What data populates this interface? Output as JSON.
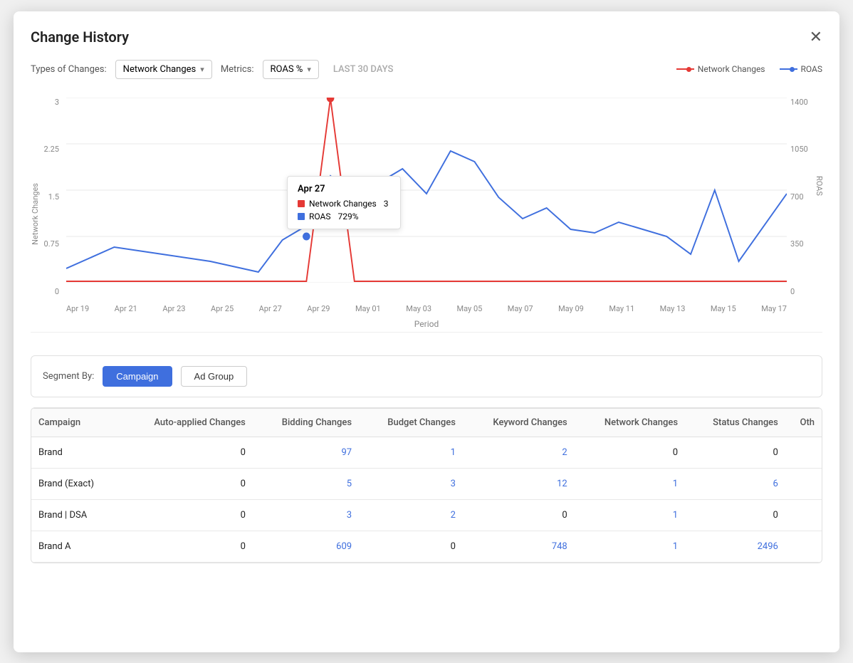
{
  "modal": {
    "title": "Change History",
    "close_label": "✕"
  },
  "controls": {
    "types_label": "Types of Changes:",
    "types_value": "Network Changes",
    "metrics_label": "Metrics:",
    "metrics_value": "ROAS %",
    "date_range": "LAST 30 DAYS"
  },
  "legend": {
    "network_changes": "Network Changes",
    "roas": "ROAS"
  },
  "chart": {
    "x_axis_label": "Period",
    "y_left_title": "Network Changes",
    "y_right_title": "ROAS",
    "x_labels": [
      "Apr 19",
      "Apr 21",
      "Apr 23",
      "Apr 25",
      "Apr 27",
      "Apr 29",
      "May 01",
      "May 03",
      "May 05",
      "May 07",
      "May 09",
      "May 11",
      "May 13",
      "May 15",
      "May 17"
    ],
    "y_left_labels": [
      "3",
      "2.25",
      "1.5",
      "0.75",
      "0"
    ],
    "y_right_labels": [
      "1400",
      "1050",
      "700",
      "350",
      "0"
    ],
    "tooltip": {
      "date": "Apr 27",
      "network_changes_label": "Network Changes",
      "network_changes_value": "3",
      "roas_label": "ROAS",
      "roas_value": "729%"
    }
  },
  "segment": {
    "label": "Segment By:",
    "campaign_btn": "Campaign",
    "adgroup_btn": "Ad Group"
  },
  "table": {
    "columns": [
      "Campaign",
      "Auto-applied Changes",
      "Bidding Changes",
      "Budget Changes",
      "Keyword Changes",
      "Network Changes",
      "Status Changes",
      "Oth"
    ],
    "rows": [
      {
        "campaign": "Brand",
        "auto": "0",
        "bidding": "97",
        "budget": "1",
        "keyword": "2",
        "network": "0",
        "status": "0",
        "other": ""
      },
      {
        "campaign": "Brand (Exact)",
        "auto": "0",
        "bidding": "5",
        "budget": "3",
        "keyword": "12",
        "network": "1",
        "status": "6",
        "other": ""
      },
      {
        "campaign": "Brand | DSA",
        "auto": "0",
        "bidding": "3",
        "budget": "2",
        "keyword": "0",
        "network": "1",
        "status": "0",
        "other": ""
      },
      {
        "campaign": "Brand A",
        "auto": "0",
        "bidding": "609",
        "budget": "0",
        "keyword": "748",
        "network": "1",
        "status": "2496",
        "other": ""
      }
    ],
    "links": {
      "Brand": {
        "bidding": true,
        "budget": true,
        "keyword": true
      },
      "Brand (Exact)": {
        "bidding": true,
        "budget": true,
        "keyword": true,
        "network": true,
        "status": true
      },
      "Brand | DSA": {
        "bidding": true,
        "budget": true,
        "network": true
      },
      "Brand A": {
        "bidding": true,
        "keyword": true,
        "network": true,
        "status": true
      }
    }
  }
}
